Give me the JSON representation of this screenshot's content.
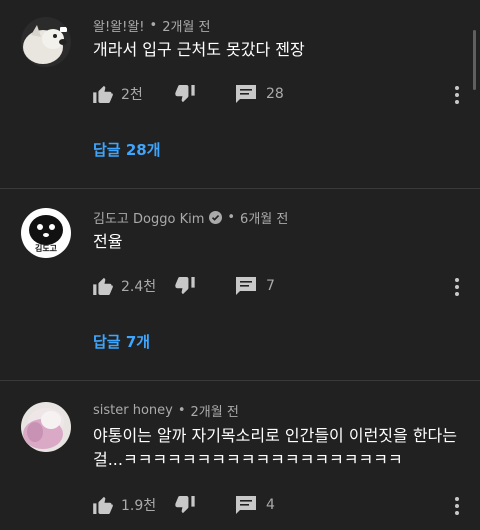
{
  "comments": [
    {
      "author": "왈!왈!왈!",
      "time": "2개월 전",
      "text": "개라서 입구 근처도 못갔다 젠장",
      "likes": "2천",
      "replies_count": "28",
      "view_replies": "답글 28개"
    },
    {
      "author": "김도고 Doggo Kim",
      "verified": true,
      "avatar_text": "김도고",
      "time": "6개월 전",
      "text": "전율",
      "likes": "2.4천",
      "replies_count": "7",
      "view_replies": "답글 7개"
    },
    {
      "author": "sister honey",
      "time": "2개월 전",
      "text": "야통이는 알까 자기목소리로 인간들이 이런짓을 한다는걸...ㅋㅋㅋㅋㅋㅋㅋㅋㅋㅋㅋㅋㅋㅋㅋㅋㅋㅋㅋ",
      "likes": "1.9천",
      "replies_count": "4"
    }
  ],
  "meta_separator": "•",
  "colors": {
    "background": "#212121",
    "link": "#3ea6ff",
    "secondary_text": "#aaaaaa"
  },
  "icons": [
    "thumbs-up-icon",
    "thumbs-down-icon",
    "reply-icon",
    "more-vert-icon",
    "verified-check-icon"
  ]
}
